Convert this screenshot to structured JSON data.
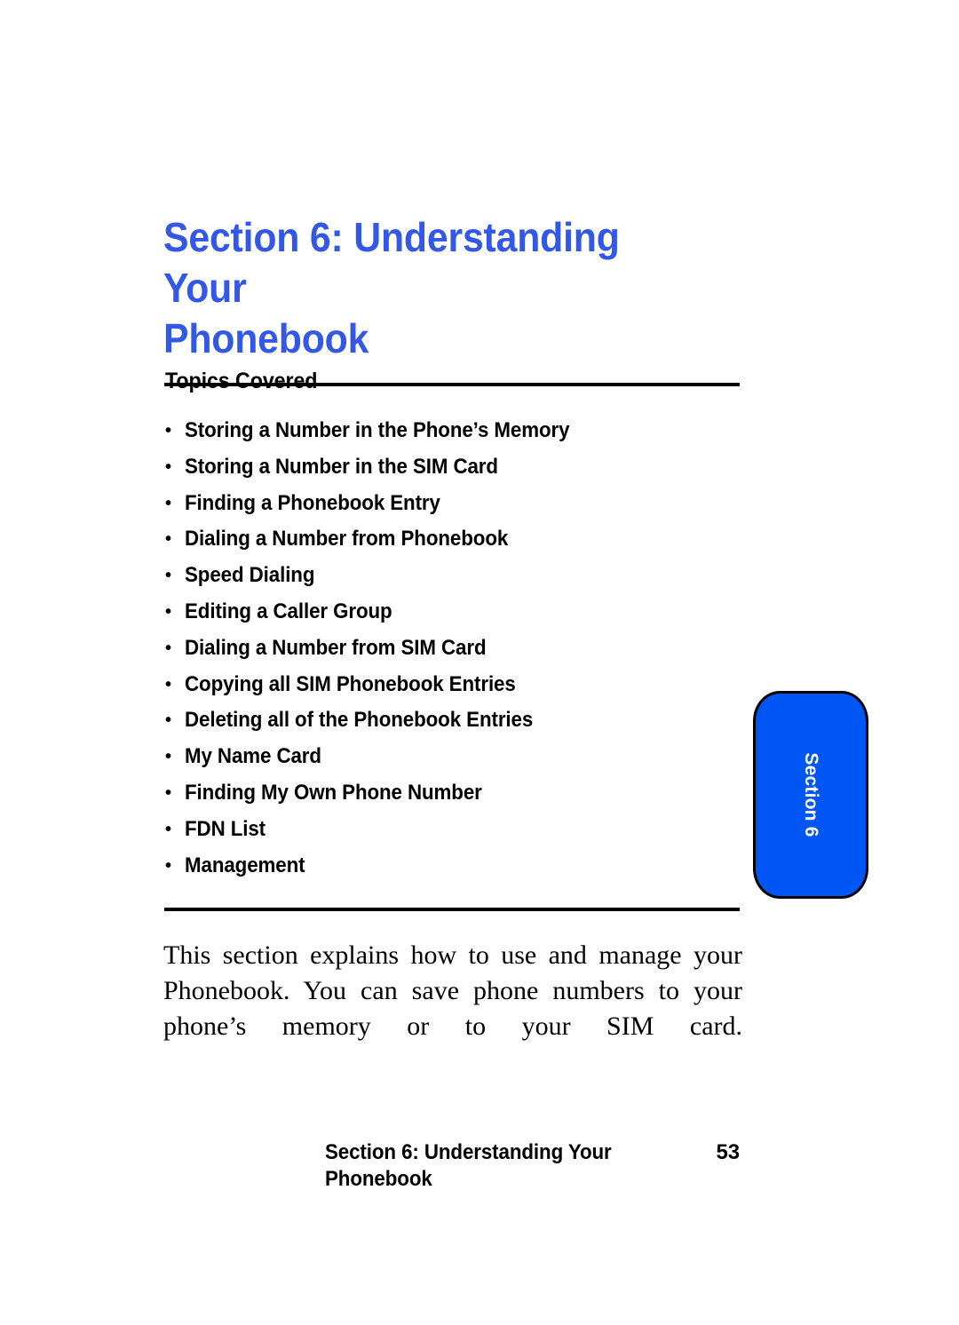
{
  "page": {
    "background_color": "#ffffff",
    "accent_blue": "#3358e8",
    "tab_blue": "#0055f5"
  },
  "section_title": {
    "line1": "Section 6: Understanding Your",
    "line2": "Phonebook",
    "full": "Section 6: Understanding Your Phonebook"
  },
  "topics": {
    "heading": "Topics Covered",
    "bullet_glyph": "•",
    "items": [
      {
        "label": "Storing a Number in the Phone’s Memory"
      },
      {
        "label": "Storing a Number in the SIM Card"
      },
      {
        "label": "Finding a Phonebook Entry"
      },
      {
        "label": "Dialing a Number from Phonebook"
      },
      {
        "label": "Speed Dialing"
      },
      {
        "label": "Editing a Caller Group"
      },
      {
        "label": "Dialing a Number from SIM Card"
      },
      {
        "label": "Copying all SIM Phonebook Entries"
      },
      {
        "label": "Deleting all of the Phonebook Entries"
      },
      {
        "label": "My Name Card"
      },
      {
        "label": "Finding My Own Phone Number"
      },
      {
        "label": "FDN List"
      },
      {
        "label": "Management"
      }
    ]
  },
  "body": {
    "paragraph": "This section explains how to use and manage your Phonebook. You can save phone numbers to your phone’s memory or to your SIM card."
  },
  "section_tab": {
    "label": "Section 6"
  },
  "footer": {
    "title": "Section 6: Understanding Your Phonebook",
    "page_number": "53"
  }
}
